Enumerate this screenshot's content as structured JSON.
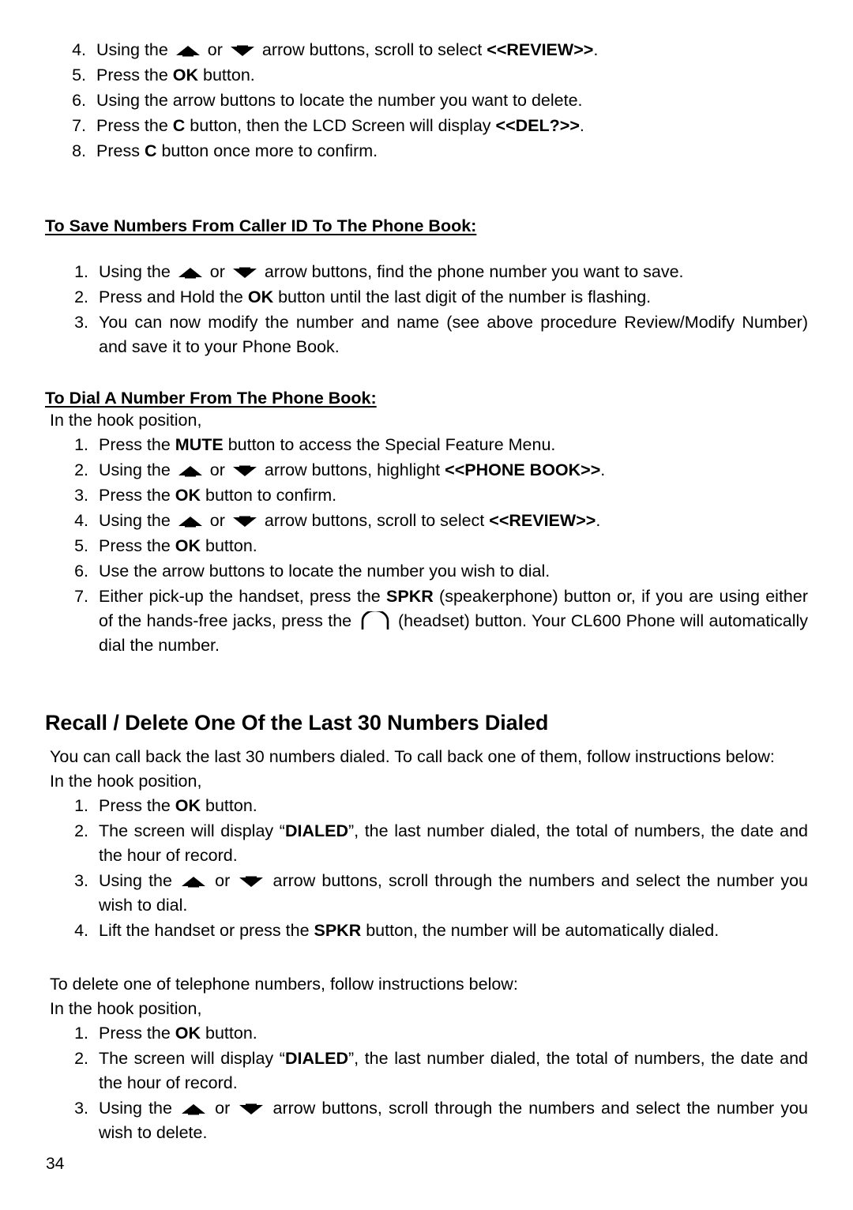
{
  "page": {
    "number": "34"
  },
  "section_delete_steps": {
    "items": [
      {
        "num": "4.",
        "pre": "Using the ",
        "icon_up": "arrow-up-icon",
        "mid": " or ",
        "icon_down": "arrow-down-icon",
        "post": " arrow buttons, scroll to select ",
        "bold": "<<REVIEW>>",
        "tail": "."
      },
      {
        "num": "5.",
        "pre": "Press the ",
        "bold": "OK",
        "post": " button."
      },
      {
        "num": "6.",
        "text": "Using the arrow buttons to locate the number you want to delete."
      },
      {
        "num": "7.",
        "pre": "Press the ",
        "bold": "C",
        "mid": " button, then the LCD Screen will display ",
        "bold2": "<<DEL?>>",
        "tail": "."
      },
      {
        "num": "8.",
        "pre": "Press ",
        "bold": "C",
        "post": " button once more to confirm."
      }
    ]
  },
  "section_save": {
    "heading": "To Save Numbers From Caller ID To The Phone Book:",
    "items": [
      {
        "num": "1.",
        "pre": "Using the ",
        "mid": " or ",
        "post": " arrow buttons, find the phone number you want to save."
      },
      {
        "num": "2.",
        "pre": "Press and Hold the ",
        "bold": "OK",
        "post": " button until the last digit of the number is flashing."
      },
      {
        "num": "3.",
        "text": "You can now modify the number and name (see above procedure Review/Modify Number) and save it to your Phone Book."
      }
    ]
  },
  "section_dial": {
    "heading": "To Dial A Number From The Phone Book:",
    "intro": "In the hook position,",
    "items": [
      {
        "num": "1.",
        "pre": "Press the ",
        "bold": "MUTE",
        "post": " button to access the Special Feature Menu."
      },
      {
        "num": "2.",
        "pre": "Using the ",
        "mid": " or ",
        "post": " arrow buttons, highlight ",
        "bold": "<<PHONE BOOK>>",
        "tail": "."
      },
      {
        "num": "3.",
        "pre": "Press the ",
        "bold": "OK",
        "post": " button to confirm."
      },
      {
        "num": "4.",
        "pre": "Using the ",
        "mid": " or ",
        "post": " arrow buttons, scroll to select ",
        "bold": "<<REVIEW>>",
        "tail": "."
      },
      {
        "num": "5.",
        "pre": "Press the ",
        "bold": "OK",
        "post": " button."
      },
      {
        "num": "6.",
        "text": "Use the arrow buttons to locate the number you wish to dial."
      },
      {
        "num": "7.",
        "pre": "Either pick-up the handset, press the ",
        "bold": "SPKR",
        "mid": " (speakerphone) button or, if you are using either of the hands-free jacks, press the ",
        "icon": "headset-icon",
        "post": " (headset) button. Your CL600 Phone will automatically dial the number."
      }
    ]
  },
  "section_recall": {
    "heading": "Recall / Delete One Of the Last 30 Numbers Dialed",
    "intro1": "You can call back the last 30 numbers dialed. To call back one of them, follow instructions below:",
    "intro2": "In the hook position,",
    "items": [
      {
        "num": "1.",
        "pre": "Press the ",
        "bold": "OK",
        "post": " button."
      },
      {
        "num": "2.",
        "pre": "The screen will display “",
        "bold": "DIALED",
        "post": "”, the last number dialed, the total of numbers, the date and the hour of record."
      },
      {
        "num": "3.",
        "pre": "Using the ",
        "mid": " or ",
        "post": " arrow buttons, scroll through the numbers and select the number you wish to dial."
      },
      {
        "num": "4.",
        "pre": "Lift the handset or press the ",
        "bold": "SPKR",
        "post": " button, the number will be automatically dialed."
      }
    ]
  },
  "section_delete_dialed": {
    "intro1": "To delete one of telephone numbers, follow instructions below:",
    "intro2": "In the hook position,",
    "items": [
      {
        "num": "1.",
        "pre": "Press the ",
        "bold": "OK",
        "post": " button."
      },
      {
        "num": "2.",
        "pre": "The screen will display “",
        "bold": "DIALED",
        "post": "”, the last number dialed, the total of numbers, the date and the hour of record."
      },
      {
        "num": "3.",
        "pre": "Using the ",
        "mid": " or ",
        "post": " arrow buttons, scroll through the numbers and select the number you wish to delete."
      }
    ]
  }
}
